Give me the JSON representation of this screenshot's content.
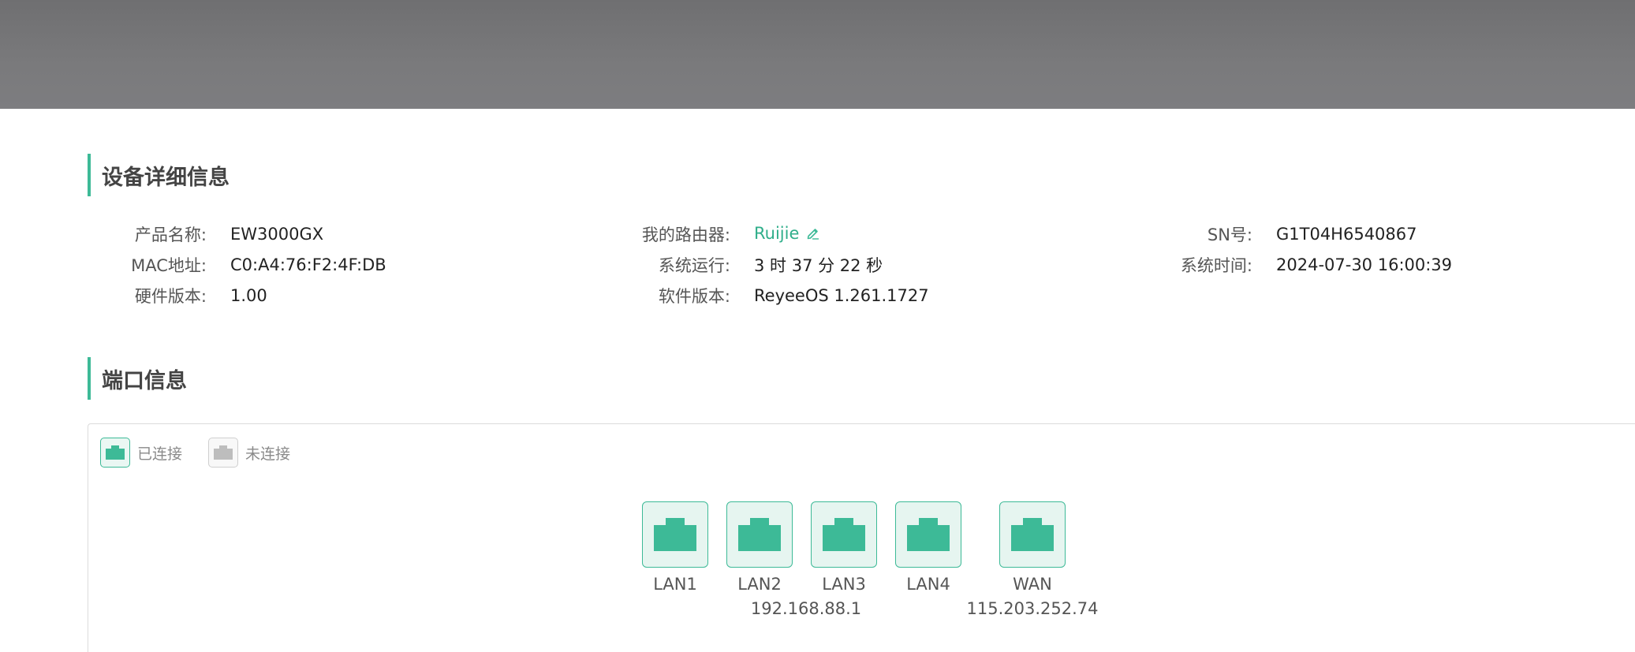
{
  "device_info": {
    "title": "设备详细信息",
    "fields": {
      "product_name": {
        "label": "产品名称:",
        "value": "EW3000GX"
      },
      "mac": {
        "label": "MAC地址:",
        "value": "C0:A4:76:F2:4F:DB"
      },
      "hardware_version": {
        "label": "硬件版本:",
        "value": "1.00"
      },
      "my_router": {
        "label": "我的路由器:",
        "value": "Ruijie"
      },
      "uptime": {
        "label": "系统运行:",
        "value": "3 时 37 分 22 秒"
      },
      "software_version": {
        "label": "软件版本:",
        "value": "ReyeeOS 1.261.1727"
      },
      "sn": {
        "label": "SN号:",
        "value": "G1T04H6540867"
      },
      "system_time": {
        "label": "系统时间:",
        "value": "2024-07-30 16:00:39"
      }
    }
  },
  "port_info": {
    "title": "端口信息",
    "legend": {
      "connected": "已连接",
      "disconnected": "未连接"
    },
    "ports": [
      {
        "name": "LAN1",
        "status": "connected"
      },
      {
        "name": "LAN2",
        "status": "connected"
      },
      {
        "name": "LAN3",
        "status": "connected"
      },
      {
        "name": "LAN4",
        "status": "connected"
      },
      {
        "name": "WAN",
        "status": "connected"
      }
    ],
    "lan_ip": "192.168.88.1",
    "wan_ip": "115.203.252.74"
  },
  "colors": {
    "accent": "#3dba97",
    "link": "#2fae8a",
    "header_bar": "#77777a",
    "port_connected_bg": "#e6f5f0",
    "port_disconnected": "#bdbdbd"
  },
  "icons": {
    "edit": "pencil-icon",
    "port": "ethernet-port-icon"
  }
}
